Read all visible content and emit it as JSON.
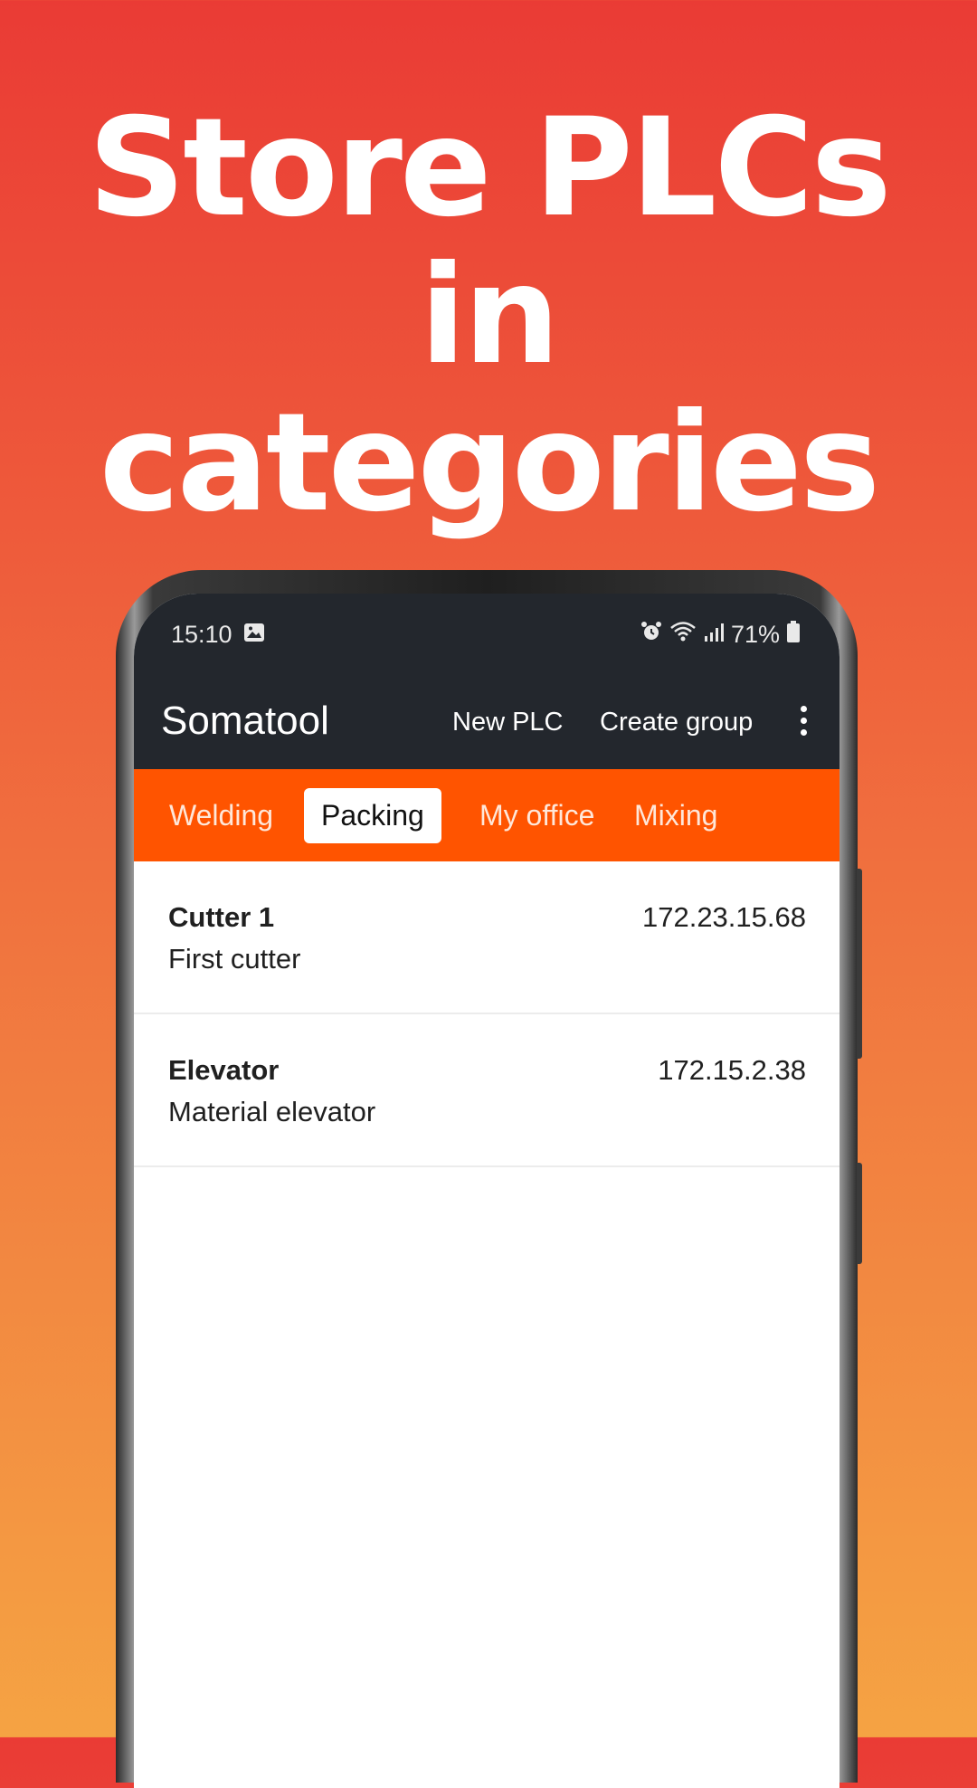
{
  "headline": {
    "line1": "Store PLCs",
    "line2": "in",
    "line3": "categories"
  },
  "status_bar": {
    "time": "15:10",
    "battery": "71%"
  },
  "app_bar": {
    "title": "Somatool",
    "actions": [
      "New PLC",
      "Create group"
    ]
  },
  "tabs": [
    {
      "label": "Welding",
      "active": false
    },
    {
      "label": "Packing",
      "active": true
    },
    {
      "label": "My office",
      "active": false
    },
    {
      "label": "Mixing",
      "active": false
    }
  ],
  "plcs": [
    {
      "name": "Cutter 1",
      "description": "First cutter",
      "ip": "172.23.15.68"
    },
    {
      "name": "Elevator",
      "description": "Material elevator",
      "ip": "172.15.2.38"
    }
  ],
  "colors": {
    "tab_bar": "#FF5400",
    "app_bar": "#23272d",
    "gradient_top": "#EA3B35",
    "gradient_bottom": "#F5A343"
  }
}
